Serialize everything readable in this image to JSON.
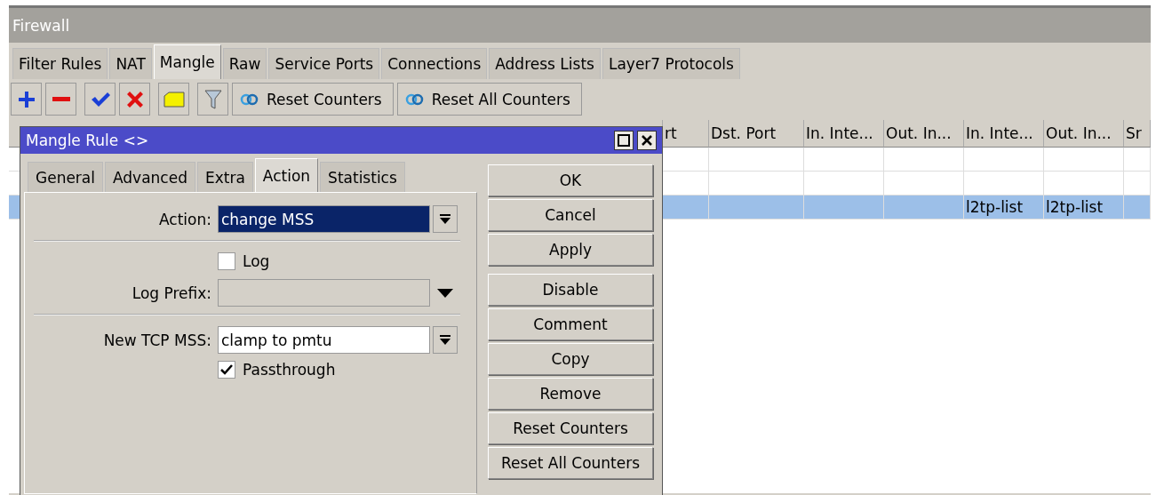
{
  "window": {
    "title": "Firewall"
  },
  "tabs": [
    {
      "label": "Filter Rules",
      "selected": false
    },
    {
      "label": "NAT",
      "selected": false
    },
    {
      "label": "Mangle",
      "selected": true
    },
    {
      "label": "Raw",
      "selected": false
    },
    {
      "label": "Service Ports",
      "selected": false
    },
    {
      "label": "Connections",
      "selected": false
    },
    {
      "label": "Address Lists",
      "selected": false
    },
    {
      "label": "Layer7 Protocols",
      "selected": false
    }
  ],
  "toolbar": [
    {
      "kind": "add"
    },
    {
      "kind": "remove"
    },
    {
      "kind": "enable"
    },
    {
      "kind": "disable"
    },
    {
      "kind": "comment"
    },
    {
      "kind": "filter"
    },
    {
      "kind": "reset",
      "label": "Reset Counters"
    },
    {
      "kind": "reset",
      "label": "Reset All Counters"
    }
  ],
  "table": {
    "columns": [
      "rt",
      "Dst. Port",
      "In. Inte...",
      "Out. In...",
      "In. Inte...",
      "Out. In...",
      "Sr"
    ],
    "rows": [
      {
        "selected": false,
        "cells": [
          null,
          null,
          null,
          null,
          null,
          null,
          null
        ]
      },
      {
        "selected": false,
        "cells": [
          null,
          null,
          null,
          null,
          null,
          null,
          null
        ]
      },
      {
        "selected": true,
        "cells": [
          null,
          null,
          null,
          null,
          "l2tp-list",
          "l2tp-list",
          null
        ]
      }
    ]
  },
  "dialog": {
    "title": "Mangle Rule <>",
    "tabs": [
      {
        "label": "General",
        "selected": false
      },
      {
        "label": "Advanced",
        "selected": false
      },
      {
        "label": "Extra",
        "selected": false
      },
      {
        "label": "Action",
        "selected": true
      },
      {
        "label": "Statistics",
        "selected": false
      }
    ],
    "fields": [
      {
        "kind": "dropdown",
        "label": "Action:",
        "value": "change MSS",
        "selected": true
      },
      {
        "kind": "separator"
      },
      {
        "kind": "checkbox",
        "label": "Log",
        "checked": false
      },
      {
        "kind": "combo",
        "label": "Log Prefix:",
        "disabled": true
      },
      {
        "kind": "separator"
      },
      {
        "kind": "dropdown",
        "label": "New TCP MSS:",
        "value": "clamp to pmtu",
        "selected": false
      },
      {
        "kind": "checkbox",
        "label": "Passthrough",
        "checked": true
      }
    ],
    "button_groups": [
      [
        "OK",
        "Cancel",
        "Apply"
      ],
      [
        "Disable",
        "Comment",
        "Copy",
        "Remove",
        "Reset Counters",
        "Reset All Counters"
      ]
    ]
  }
}
